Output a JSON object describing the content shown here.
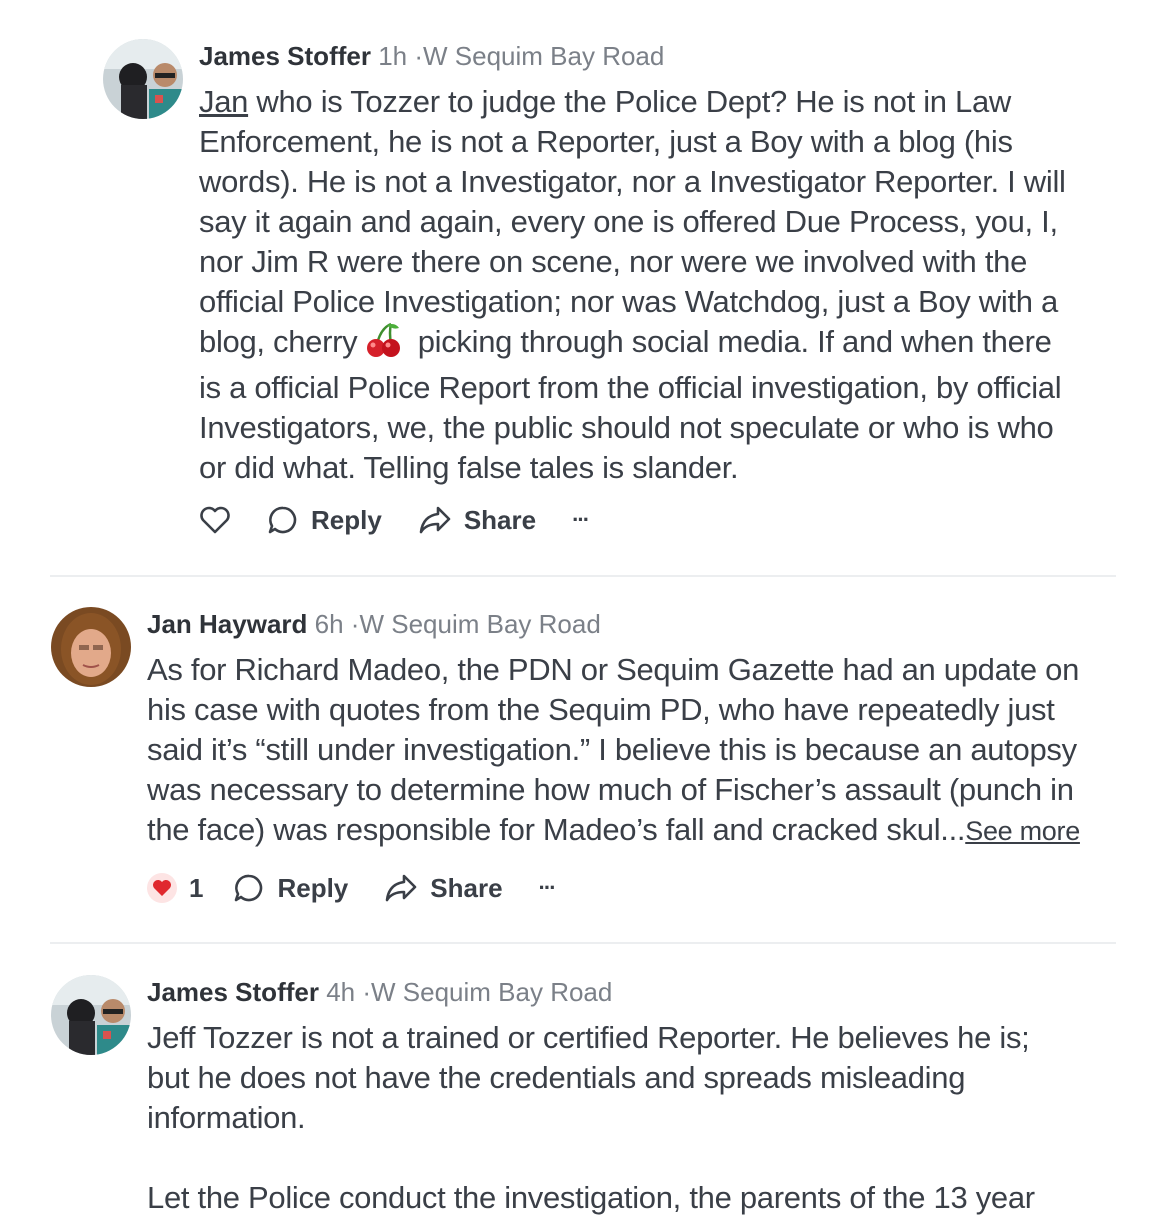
{
  "comments": [
    {
      "author": "James Stoffer",
      "time": "1h",
      "separator": "·",
      "location": "W Sequim Bay Road",
      "mention": "Jan",
      "text_lines": [
        " who is Tozzer to judge the Police Dept?  He is not in Law",
        "Enforcement, he is not a Reporter, just a Boy with a blog (his",
        "words).  He is not a Investigator, nor a Investigator  Reporter. I will",
        "say it again and again, every one is offered Due Process, you, I,",
        "nor Jim R were there on scene, nor were we involved with the",
        "official Police Investigation; nor was Watchdog, just a Boy with a",
        "blog, cherry",
        " picking through social media. If and when there",
        "is a official Police Report from the official investigation, by official",
        "Investigators, we, the public should not speculate or who is who",
        "or did what. Telling false tales is slander."
      ],
      "emoji": "cherries",
      "reply_label": "Reply",
      "share_label": "Share",
      "more_label": "···"
    },
    {
      "author": "Jan Hayward",
      "time": "6h",
      "separator": "·",
      "location": "W Sequim Bay Road",
      "text_lines": [
        "As for Richard Madeo, the PDN or Sequim Gazette had an update on",
        "his case with quotes from the Sequim PD, who have repeatedly just",
        "said it’s “still under investigation.” I believe this is because an autopsy",
        "was necessary to determine how much of Fischer’s assault (punch in",
        "the face) was responsible for Madeo’s fall and cracked skul..."
      ],
      "see_more": "See more",
      "reaction_count": "1",
      "reaction_icon": "heart-icon",
      "reaction_color": "#e0282e",
      "reply_label": "Reply",
      "share_label": "Share",
      "more_label": "···"
    },
    {
      "author": "James Stoffer",
      "time": "4h",
      "separator": "·",
      "location": "W Sequim Bay Road",
      "text_lines": [
        "Jeff Tozzer is not a trained or certified Reporter.  He believes he is;",
        "but he does not have the credentials and spreads misleading",
        "information.",
        "",
        "Let the Police conduct the investigation, the parents of the 13 year"
      ]
    }
  ]
}
